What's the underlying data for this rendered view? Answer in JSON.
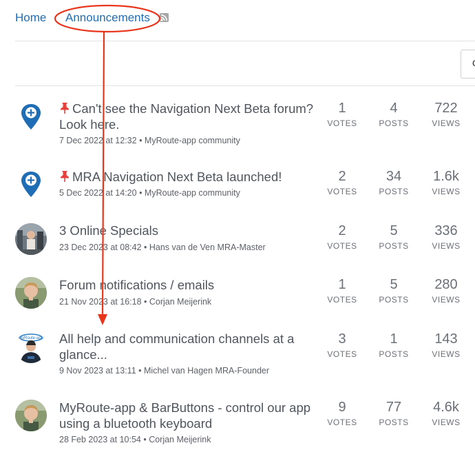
{
  "breadcrumb": {
    "home": "Home",
    "current": "Announcements"
  },
  "toolbar": {
    "partial_label": "c"
  },
  "stat_labels": {
    "votes": "VOTES",
    "posts": "POSTS",
    "views": "VIEWS"
  },
  "topics": [
    {
      "title": "Can't see the Navigation Next Beta forum? Look here.",
      "pinned": true,
      "date": "7 Dec 2022 at 12:32",
      "author": "MyRoute-app community",
      "votes": "1",
      "posts": "4",
      "views": "722"
    },
    {
      "title": "MRA Navigation Next Beta launched!",
      "pinned": true,
      "date": "5 Dec 2022 at 14:20",
      "author": "MyRoute-app community",
      "votes": "2",
      "posts": "34",
      "views": "1.6k"
    },
    {
      "title": "3 Online Specials",
      "pinned": false,
      "date": "23 Dec 2023 at 08:42",
      "author": "Hans van de Ven MRA-Master",
      "votes": "2",
      "posts": "5",
      "views": "336"
    },
    {
      "title": "Forum notifications / emails",
      "pinned": false,
      "date": "21 Nov 2023 at 16:18",
      "author": "Corjan Meijerink",
      "votes": "1",
      "posts": "5",
      "views": "280"
    },
    {
      "title": "All help and communication channels at a glance...",
      "pinned": false,
      "date": "9 Nov 2023 at 13:11",
      "author": "Michel van Hagen MRA-Founder",
      "votes": "3",
      "posts": "1",
      "views": "143"
    },
    {
      "title": "MyRoute-app & BarButtons - control our app using a bluetooth keyboard",
      "pinned": false,
      "date": "28 Feb 2023 at 10:54",
      "author": "Corjan Meijerink",
      "votes": "9",
      "posts": "77",
      "views": "4.6k"
    }
  ],
  "meta_separator": " • ",
  "colors": {
    "link": "#1f6db5",
    "annotation": "#e8361c",
    "pin": "#e8413c",
    "map_pin": "#1f6db5"
  }
}
